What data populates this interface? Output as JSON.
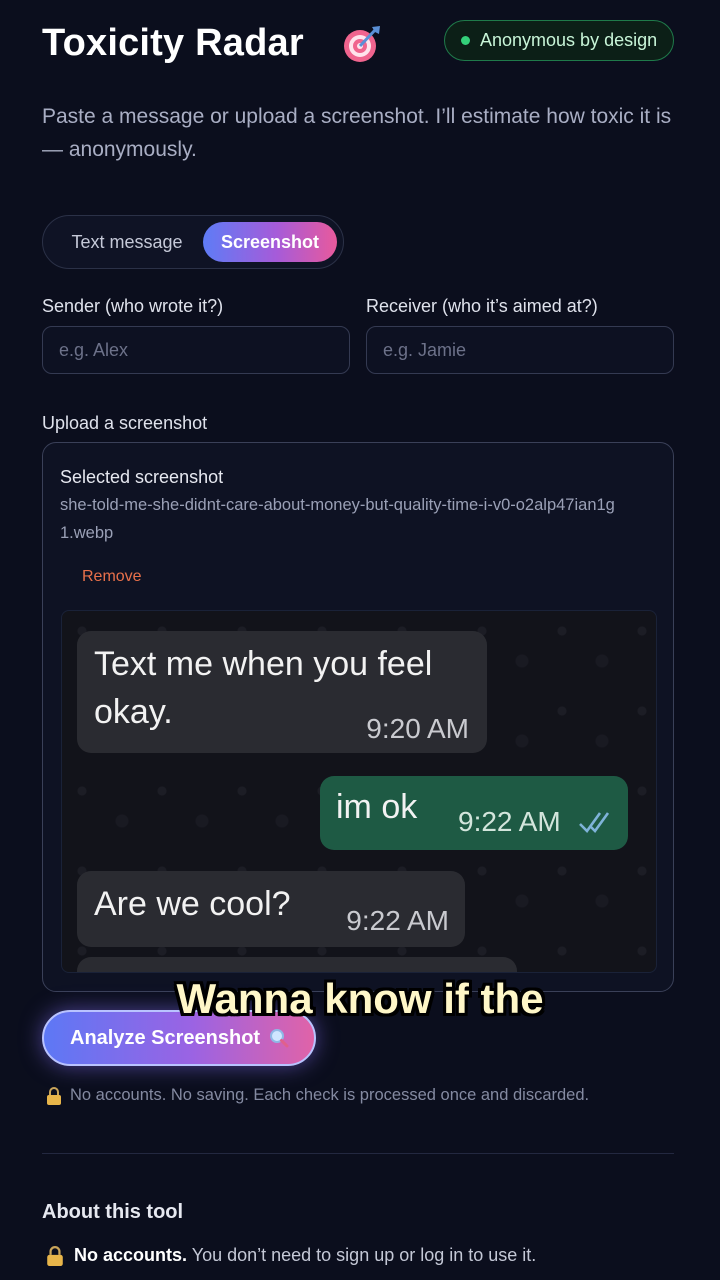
{
  "header": {
    "title": "Toxicity Radar",
    "badge": "Anonymous by design",
    "subtitle": "Paste a message or upload a screenshot. I’ll estimate how toxic it is — anonymously."
  },
  "mode_toggle": {
    "options": [
      "Text message",
      "Screenshot"
    ],
    "selected": "Screenshot"
  },
  "form": {
    "sender_label": "Sender (who wrote it?)",
    "sender_placeholder": "e.g. Alex",
    "receiver_label": "Receiver (who it’s aimed at?)",
    "receiver_placeholder": "e.g. Jamie",
    "upload_label": "Upload a screenshot"
  },
  "upload": {
    "selected_label": "Selected screenshot",
    "filename": "she-told-me-she-didnt-care-about-money-but-quality-time-i-v0-o2alp47ian1g1.webp",
    "remove_label": "Remove"
  },
  "preview": {
    "messages": [
      {
        "direction": "incoming",
        "line1": "Text me when you feel",
        "line2": "okay.",
        "time": "9:20 AM"
      },
      {
        "direction": "outgoing",
        "text": "im ok",
        "time": "9:22 AM",
        "read": true
      },
      {
        "direction": "incoming",
        "text": "Are we cool?",
        "time": "9:22 AM"
      }
    ]
  },
  "actions": {
    "analyze_label": "Analyze Screenshot",
    "privacy_note": "No accounts. No saving. Each check is processed once and discarded."
  },
  "about": {
    "title": "About this tool",
    "line_bold": "No accounts.",
    "line_rest": "You don’t need to sign up or log in to use it."
  },
  "overlay_caption": "Wanna know if the",
  "colors": {
    "background": "#0b0e1d",
    "accent_start": "#5e7cf6",
    "accent_end": "#e85a9c",
    "badge_green": "#34d07a",
    "remove_orange": "#e8704a"
  },
  "icons": [
    "target-icon",
    "lock-icon",
    "magnifier-icon",
    "double-check-icon"
  ]
}
